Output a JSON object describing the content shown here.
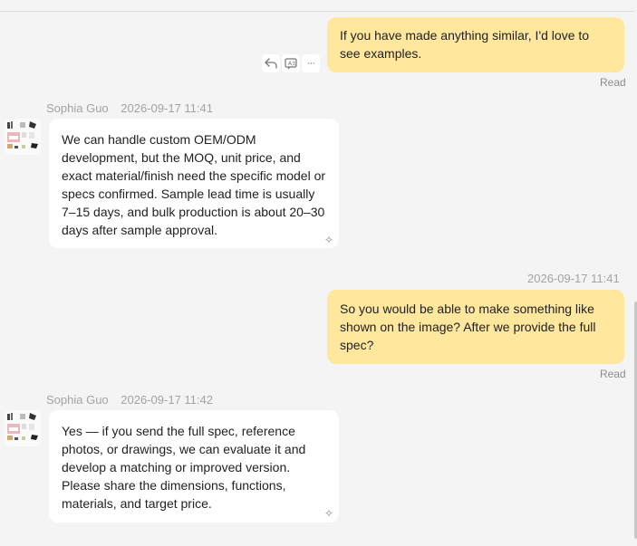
{
  "messages": [
    {
      "text": "If you have made anything similar, I'd love to see examples.",
      "status": "Read"
    },
    {
      "sender": "Sophia Guo",
      "time": "2026-09-17 11:41",
      "text": "We can handle custom OEM/ODM development, but the MOQ, unit price, and exact material/finish need the specific model or specs confirmed. Sample lead time is usually 7–15 days, and bulk production is about 20–30 days after sample approval."
    },
    {
      "time": "2026-09-17 11:41",
      "text": "So you would be able to make something like shown on the image? After we provide the full spec?",
      "status": "Read"
    },
    {
      "sender": "Sophia Guo",
      "time": "2026-09-17 11:42",
      "text": "Yes — if you send the full spec, reference photos, or drawings, we can evaluate it and develop a matching or improved version. Please share the dimensions, functions, materials, and target price."
    }
  ],
  "message_actions": {
    "icons": [
      "reply-icon",
      "translate-icon",
      "more-icon"
    ],
    "more_label": "···"
  },
  "ai_marker_icon": "sparkle-icon",
  "ai_marker_glyph": "✧",
  "colors": {
    "my_bubble": "#ffe79e",
    "their_bubble": "#ffffff",
    "background": "#f4f4f4",
    "meta_text": "#a3a3a3"
  }
}
